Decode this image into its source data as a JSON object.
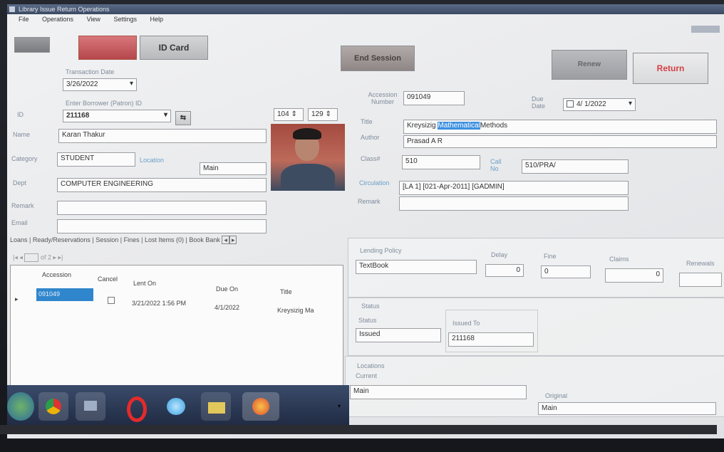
{
  "window": {
    "title": "Library Issue Return Operations"
  },
  "menu": [
    "File",
    "Operations",
    "View",
    "Settings",
    "Help"
  ],
  "toolbar": {
    "id_card": "ID Card",
    "end_session": "End Session",
    "renew": "Renew",
    "return": "Return"
  },
  "transaction": {
    "date_label": "Transaction Date",
    "date_value": "3/26/2022"
  },
  "borrower": {
    "id_label": "Enter Borrower (Patron) ID",
    "id_value": "211168",
    "name_label": "Name",
    "name_value": "Karan Thakur",
    "category_label": "Category",
    "category_value": "STUDENT",
    "location_label": "Location",
    "location_value": "Main",
    "dept_label": "Dept",
    "dept_value": "COMPUTER ENGINEERING",
    "remark_label": "Remark",
    "remark_value": "",
    "email_label": "Email",
    "email_value": ""
  },
  "spinners": {
    "left": "104",
    "right": "129"
  },
  "book": {
    "accession_label": "Accession Number",
    "accession_value": "091049",
    "due_label": "Due Date",
    "due_value": "4/ 1/2022",
    "title_label": "Title",
    "title_prefix": "Kreysizig",
    "title_highlight": "Mathematical",
    "title_suffix": "Methods",
    "author_label": "Author",
    "author_value": "Prasad A R",
    "classno_label": "Class#",
    "classno_value": "510",
    "callno_label": "Call No",
    "callno_value": "510/PRA/",
    "circ_label": "Circulation",
    "circ_value": "[LA 1] [021-Apr-2011] [GADMIN]",
    "remark_label": "Remark",
    "remark_value": ""
  },
  "tabs": [
    "Loans",
    "Ready/Reservations",
    "Session",
    "Fines",
    "Lost Items (0)",
    "Book Bank"
  ],
  "pager": {
    "of_label": "of 2"
  },
  "loans_table": {
    "columns": [
      "Accession",
      "Cancel",
      "Lent On",
      "Due On",
      "Title"
    ],
    "rows": [
      {
        "accession": "091049",
        "lent_on": "3/21/2022 1:56 PM",
        "due_on": "4/1/2022",
        "title": "Kreysizig Ma"
      }
    ]
  },
  "lending_policy": {
    "label": "Lending Policy",
    "value": "TextBook",
    "delay_label": "Delay",
    "delay_value": "0",
    "fine_label": "Fine",
    "fine_value": "0",
    "claims_label": "Claims",
    "claims_value": "0",
    "renewals_label": "Renewals",
    "renewals_value": ""
  },
  "status": {
    "group_label": "Status",
    "status_label": "Status",
    "status_value": "Issued",
    "issued_to_label": "Issued To",
    "issued_to_value": "211168"
  },
  "locations": {
    "group_label": "Locations",
    "current_label": "Current",
    "current_value": "Main",
    "original_label": "Original",
    "original_value": "Main"
  },
  "colors": {
    "highlight": "#3d8fe0",
    "accent_button": "#c9363c",
    "grid_selection": "#2f86cc"
  }
}
